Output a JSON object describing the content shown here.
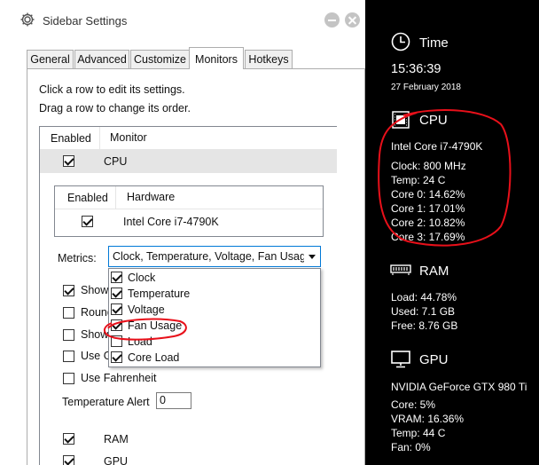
{
  "window": {
    "title": "Sidebar Settings",
    "tabs": [
      {
        "label": "General",
        "active": false
      },
      {
        "label": "Advanced",
        "active": false
      },
      {
        "label": "Customize",
        "active": false
      },
      {
        "label": "Monitors",
        "active": true
      },
      {
        "label": "Hotkeys",
        "active": false
      }
    ],
    "hint1": "Click a row to edit its settings.",
    "hint2": "Drag a row to change its order.",
    "list_headers": {
      "enabled": "Enabled",
      "monitor": "Monitor"
    },
    "cpu_row": {
      "label": "CPU",
      "checked": true
    },
    "hardware_headers": {
      "enabled": "Enabled",
      "hardware": "Hardware"
    },
    "hardware_row": {
      "label": "Intel Core i7-4790K",
      "checked": true
    },
    "metrics_label": "Metrics:",
    "metrics_value": "Clock, Temperature, Voltage, Fan Usage, C",
    "options": [
      {
        "label": "Show",
        "checked": true
      },
      {
        "label": "Round",
        "checked": false
      },
      {
        "label": "Show",
        "checked": false
      },
      {
        "label": "Use G",
        "checked": false
      },
      {
        "label": "Use Fahrenheit",
        "checked": false
      }
    ],
    "dropdown_items": [
      {
        "label": "Clock",
        "checked": true
      },
      {
        "label": "Temperature",
        "checked": true
      },
      {
        "label": "Voltage",
        "checked": true
      },
      {
        "label": "Fan Usage",
        "checked": true
      },
      {
        "label": "Load",
        "checked": false
      },
      {
        "label": "Core Load",
        "checked": true
      }
    ],
    "temp_alert_label": "Temperature Alert",
    "temp_alert_value": "0",
    "monitor_rows": [
      {
        "label": "RAM",
        "checked": true
      },
      {
        "label": "GPU",
        "checked": true
      }
    ]
  },
  "sidebar": {
    "time": {
      "title": "Time",
      "clock": "15:36:39",
      "date": "27 February 2018",
      "icon": "clock-icon"
    },
    "cpu": {
      "title": "CPU",
      "icon": "cpu-chip-icon",
      "name": "Intel Core i7-4790K",
      "lines": [
        "Clock: 800 MHz",
        "Temp: 24 C",
        "Core 0: 14.62%",
        "Core 1: 17.01%",
        "Core 2: 10.82%",
        "Core 3: 17.69%"
      ]
    },
    "ram": {
      "title": "RAM",
      "icon": "ram-module-icon",
      "lines": [
        "Load: 44.78%",
        "Used: 7.1 GB",
        "Free: 8.76 GB"
      ]
    },
    "gpu": {
      "title": "GPU",
      "icon": "monitor-icon",
      "name": "NVIDIA GeForce GTX 980 Ti",
      "lines": [
        "Core: 5%",
        "VRAM: 16.36%",
        "Temp: 44 C",
        "Fan: 0%"
      ]
    }
  },
  "colors": {
    "annotation": "#e8101a",
    "sidebar_bg": "#000000",
    "accent": "#0078d7"
  }
}
